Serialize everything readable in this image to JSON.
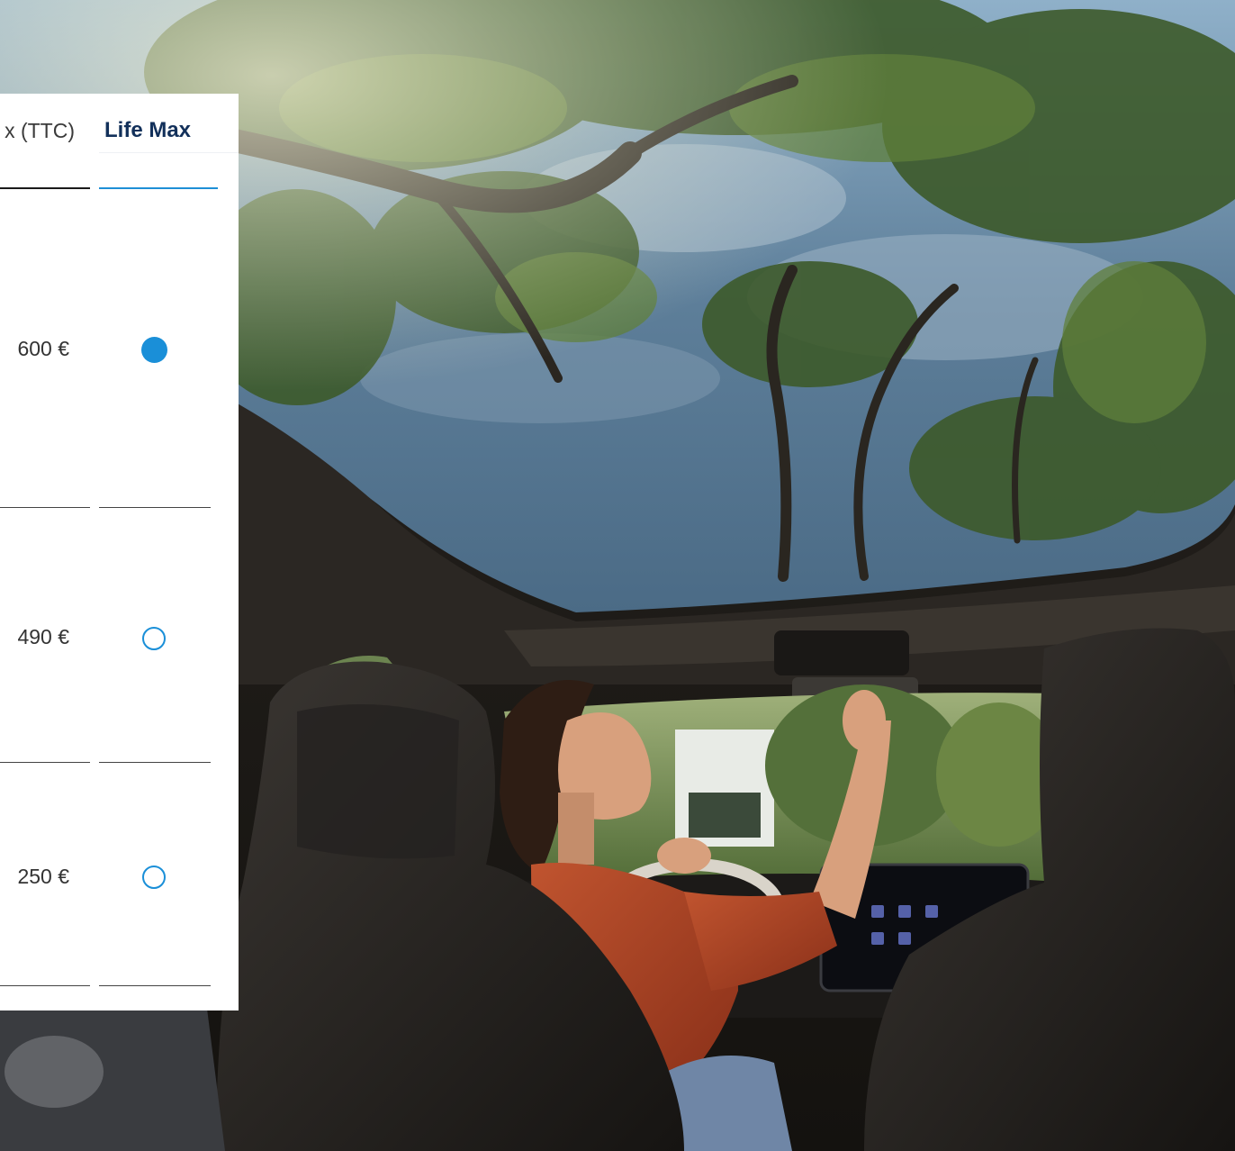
{
  "table": {
    "header": {
      "price_label": "x (TTC)",
      "model_label": "Life Max"
    },
    "rows": [
      {
        "price": "600 €",
        "selected": true
      },
      {
        "price": "490 €",
        "selected": false
      },
      {
        "price": "250 €",
        "selected": false
      }
    ]
  },
  "colors": {
    "accent": "#1a8fd8",
    "heading": "#12305a"
  }
}
